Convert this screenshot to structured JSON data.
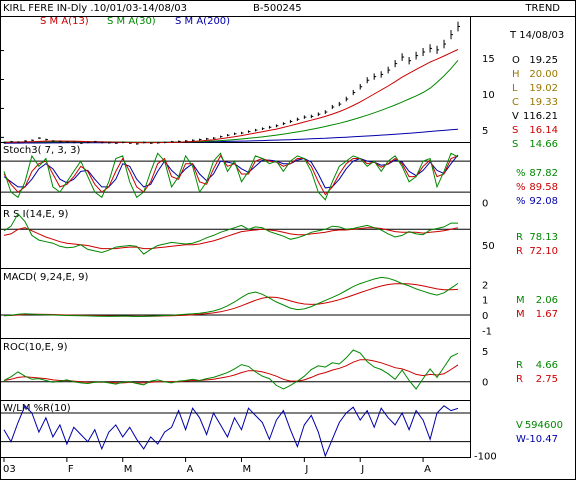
{
  "header": {
    "title": "KIRL FERE IN-Dly .10/01/03-14/08/03",
    "code": "B-500245",
    "trend_label": "TREND",
    "sma_labels": [
      {
        "text": "S M A(13)",
        "color": "#cc0000"
      },
      {
        "text": "S M A(30)",
        "color": "#008800"
      },
      {
        "text": "S M A(200)",
        "color": "#0000aa"
      }
    ]
  },
  "price_info": {
    "date": "T 14/08/03",
    "rows": [
      {
        "k": "O",
        "v": "19.25",
        "color": "#000000"
      },
      {
        "k": "H",
        "v": "20.00",
        "color": "#997700"
      },
      {
        "k": "L",
        "v": "19.02",
        "color": "#997700"
      },
      {
        "k": "C",
        "v": "19.33",
        "color": "#997700"
      },
      {
        "k": "V",
        "v": "116.21",
        "color": "#000000"
      },
      {
        "k": "S",
        "v": "16.14",
        "color": "#cc0000"
      },
      {
        "k": "S",
        "v": "14.66",
        "color": "#008800"
      }
    ]
  },
  "panels": {
    "stoch": {
      "label": "Stoch3( 7, 3, 3)",
      "readouts": [
        {
          "k": "%",
          "v": "87.82",
          "color": "#008800"
        },
        {
          "k": "%",
          "v": "89.58",
          "color": "#cc0000"
        },
        {
          "k": "%",
          "v": "92.08",
          "color": "#0000aa"
        }
      ]
    },
    "rsi": {
      "label": "R S I(14,E, 9)",
      "readouts": [
        {
          "k": "R",
          "v": "78.13",
          "color": "#008800"
        },
        {
          "k": "R",
          "v": "72.10",
          "color": "#cc0000"
        }
      ]
    },
    "macd": {
      "label": "MACD( 9,24,E, 9)",
      "readouts": [
        {
          "k": "M",
          "v": "2.06",
          "color": "#008800"
        },
        {
          "k": "M",
          "v": "1.67",
          "color": "#cc0000"
        }
      ]
    },
    "roc": {
      "label": "ROC(10,E, 9)",
      "readouts": [
        {
          "k": "R",
          "v": "4.66",
          "color": "#008800"
        },
        {
          "k": "R",
          "v": "2.75",
          "color": "#cc0000"
        }
      ]
    },
    "wlm": {
      "label": "W/LM %R(10)",
      "readouts": [
        {
          "k": "V",
          "v": "594600",
          "color": "#008800"
        },
        {
          "k": "W",
          "v": "-10.47",
          "color": "#0000aa"
        }
      ]
    }
  },
  "chart_data": {
    "type": "line",
    "x_month_labels": [
      "03",
      "F",
      "M",
      "A",
      "M",
      "J",
      "J",
      "A"
    ],
    "price_axis_ticks": [
      15,
      10,
      5
    ],
    "stoch_axis_ticks": [
      0
    ],
    "rsi_axis_ticks": [
      50
    ],
    "macd_axis_ticks": [
      2,
      1,
      0,
      -1
    ],
    "roc_axis_ticks": [
      5,
      0
    ],
    "wlm_axis_ticks": [
      -100
    ],
    "price": {
      "ylim": [
        3.5,
        20.5
      ],
      "close": [
        3.3,
        3.4,
        3.35,
        3.5,
        3.6,
        3.9,
        3.7,
        3.5,
        3.4,
        3.35,
        3.3,
        3.2,
        3.3,
        3.4,
        3.3,
        3.25,
        3.2,
        3.3,
        3.2,
        3.1,
        3.3,
        3.2,
        3.25,
        3.3,
        3.4,
        3.45,
        3.5,
        3.6,
        3.7,
        3.8,
        3.9,
        4.1,
        4.3,
        4.5,
        4.6,
        4.8,
        5.0,
        5.2,
        5.4,
        5.6,
        5.9,
        6.2,
        6.5,
        6.8,
        6.9,
        7.2,
        7.5,
        8.2,
        8.6,
        9.3,
        10.2,
        11.0,
        11.9,
        12.4,
        12.7,
        13.3,
        14.2,
        15.1,
        14.6,
        15.3,
        15.8,
        16.3,
        16.1,
        16.9,
        18.2,
        19.33
      ],
      "sma13": [
        3.3,
        3.33,
        3.35,
        3.38,
        3.4,
        3.45,
        3.48,
        3.5,
        3.5,
        3.49,
        3.48,
        3.45,
        3.42,
        3.4,
        3.37,
        3.35,
        3.32,
        3.3,
        3.29,
        3.28,
        3.27,
        3.28,
        3.28,
        3.29,
        3.31,
        3.34,
        3.38,
        3.43,
        3.5,
        3.58,
        3.67,
        3.8,
        3.95,
        4.1,
        4.25,
        4.42,
        4.6,
        4.78,
        4.96,
        5.15,
        5.38,
        5.62,
        5.87,
        6.12,
        6.37,
        6.62,
        6.9,
        7.22,
        7.56,
        7.95,
        8.4,
        8.9,
        9.45,
        10.0,
        10.55,
        11.1,
        11.7,
        12.32,
        12.86,
        13.4,
        13.9,
        14.4,
        14.8,
        15.25,
        15.7,
        16.14
      ],
      "sma30": [
        3.35,
        3.36,
        3.36,
        3.37,
        3.37,
        3.38,
        3.38,
        3.39,
        3.39,
        3.39,
        3.39,
        3.39,
        3.38,
        3.38,
        3.38,
        3.37,
        3.36,
        3.36,
        3.35,
        3.34,
        3.34,
        3.33,
        3.33,
        3.33,
        3.34,
        3.35,
        3.37,
        3.39,
        3.42,
        3.46,
        3.5,
        3.56,
        3.62,
        3.7,
        3.78,
        3.87,
        3.97,
        4.07,
        4.19,
        4.31,
        4.45,
        4.6,
        4.76,
        4.93,
        5.11,
        5.3,
        5.5,
        5.72,
        5.95,
        6.2,
        6.47,
        6.76,
        7.07,
        7.4,
        7.74,
        8.1,
        8.48,
        8.88,
        9.3,
        9.74,
        10.2,
        10.8,
        11.6,
        12.5,
        13.5,
        14.66
      ],
      "sma200": [
        3.2,
        3.21,
        3.21,
        3.22,
        3.22,
        3.23,
        3.23,
        3.24,
        3.24,
        3.25,
        3.25,
        3.26,
        3.26,
        3.27,
        3.27,
        3.28,
        3.28,
        3.29,
        3.29,
        3.3,
        3.3,
        3.31,
        3.31,
        3.32,
        3.33,
        3.34,
        3.35,
        3.36,
        3.37,
        3.38,
        3.4,
        3.42,
        3.44,
        3.46,
        3.48,
        3.5,
        3.53,
        3.56,
        3.59,
        3.62,
        3.65,
        3.68,
        3.72,
        3.76,
        3.8,
        3.84,
        3.88,
        3.93,
        3.98,
        4.03,
        4.08,
        4.13,
        4.19,
        4.25,
        4.31,
        4.37,
        4.44,
        4.51,
        4.58,
        4.65,
        4.73,
        4.81,
        4.89,
        4.97,
        5.05,
        5.13
      ]
    },
    "stoch": {
      "ylim": [
        -5,
        115
      ],
      "guides": [
        20,
        80
      ],
      "k": [
        60,
        20,
        10,
        40,
        90,
        70,
        85,
        30,
        20,
        40,
        60,
        80,
        50,
        20,
        10,
        40,
        85,
        90,
        40,
        10,
        20,
        60,
        95,
        80,
        30,
        50,
        90,
        70,
        20,
        40,
        80,
        95,
        60,
        80,
        40,
        60,
        90,
        85,
        75,
        80,
        60,
        80,
        90,
        85,
        60,
        20,
        5,
        40,
        70,
        80,
        90,
        85,
        70,
        80,
        60,
        80,
        90,
        70,
        40,
        50,
        80,
        85,
        30,
        60,
        95,
        88
      ],
      "d": [
        55,
        35,
        20,
        30,
        60,
        75,
        80,
        55,
        30,
        35,
        50,
        70,
        60,
        35,
        20,
        30,
        60,
        85,
        60,
        30,
        20,
        40,
        75,
        85,
        50,
        45,
        75,
        75,
        40,
        35,
        65,
        90,
        70,
        75,
        55,
        55,
        80,
        85,
        80,
        78,
        70,
        75,
        85,
        85,
        70,
        40,
        15,
        30,
        55,
        75,
        85,
        85,
        75,
        78,
        68,
        75,
        85,
        75,
        50,
        50,
        70,
        82,
        50,
        55,
        85,
        90
      ],
      "sd": [
        50,
        40,
        30,
        30,
        45,
        65,
        75,
        65,
        45,
        38,
        45,
        60,
        62,
        45,
        30,
        30,
        45,
        75,
        70,
        45,
        30,
        35,
        60,
        80,
        62,
        50,
        65,
        75,
        55,
        42,
        55,
        80,
        78,
        75,
        65,
        58,
        70,
        82,
        82,
        80,
        75,
        75,
        82,
        85,
        78,
        55,
        28,
        30,
        45,
        65,
        80,
        85,
        80,
        78,
        72,
        74,
        82,
        78,
        60,
        52,
        62,
        78,
        62,
        56,
        75,
        92
      ]
    },
    "rsi": {
      "ylim": [
        20,
        100
      ],
      "guide": 70,
      "rsi": [
        68,
        74,
        90,
        80,
        62,
        56,
        54,
        52,
        48,
        46,
        47,
        50,
        44,
        42,
        40,
        43,
        47,
        48,
        49,
        48,
        38,
        44,
        49,
        51,
        53,
        52,
        51,
        52,
        55,
        59,
        62,
        66,
        69,
        72,
        75,
        70,
        73,
        72,
        67,
        64,
        61,
        57,
        59,
        62,
        66,
        68,
        70,
        74,
        73,
        70,
        71,
        73,
        75,
        72,
        69,
        64,
        60,
        62,
        67,
        64,
        63,
        69,
        71,
        73,
        78,
        78
      ],
      "signal": [
        62,
        64,
        70,
        72,
        68,
        64,
        60,
        57,
        54,
        52,
        51,
        50,
        49,
        47,
        45,
        45,
        45,
        46,
        47,
        47,
        45,
        45,
        46,
        47,
        48,
        49,
        50,
        50,
        51,
        53,
        55,
        58,
        61,
        64,
        67,
        68,
        69,
        70,
        69,
        68,
        66,
        64,
        63,
        63,
        64,
        65,
        66,
        68,
        69,
        69,
        70,
        71,
        72,
        72,
        71,
        69,
        67,
        66,
        66,
        66,
        65,
        66,
        67,
        68,
        70,
        72
      ]
    },
    "macd": {
      "ylim": [
        -1.5,
        3.0
      ],
      "guide": 0,
      "macd": [
        -0.05,
        -0.02,
        0.05,
        0.08,
        0.06,
        0.03,
        0.02,
        0.0,
        -0.02,
        -0.03,
        -0.04,
        -0.05,
        -0.06,
        -0.07,
        -0.08,
        -0.09,
        -0.08,
        -0.07,
        -0.08,
        -0.1,
        -0.09,
        -0.07,
        -0.05,
        -0.03,
        -0.01,
        0.02,
        0.05,
        0.08,
        0.12,
        0.18,
        0.26,
        0.4,
        0.6,
        0.85,
        1.15,
        1.4,
        1.5,
        1.35,
        1.1,
        0.85,
        0.65,
        0.45,
        0.35,
        0.4,
        0.55,
        0.75,
        0.95,
        1.15,
        1.35,
        1.6,
        1.85,
        2.05,
        2.2,
        2.35,
        2.45,
        2.4,
        2.25,
        2.05,
        1.9,
        1.7,
        1.55,
        1.4,
        1.3,
        1.45,
        1.75,
        2.06
      ],
      "signal": [
        -0.04,
        -0.03,
        0.0,
        0.03,
        0.05,
        0.05,
        0.04,
        0.03,
        0.02,
        0.0,
        -0.01,
        -0.02,
        -0.03,
        -0.04,
        -0.05,
        -0.06,
        -0.07,
        -0.07,
        -0.07,
        -0.08,
        -0.08,
        -0.08,
        -0.07,
        -0.06,
        -0.05,
        -0.03,
        -0.01,
        0.02,
        0.05,
        0.09,
        0.14,
        0.21,
        0.31,
        0.44,
        0.6,
        0.78,
        0.96,
        1.1,
        1.17,
        1.15,
        1.05,
        0.92,
        0.8,
        0.72,
        0.69,
        0.71,
        0.78,
        0.88,
        1.0,
        1.14,
        1.3,
        1.46,
        1.61,
        1.76,
        1.89,
        1.99,
        2.04,
        2.05,
        2.03,
        1.98,
        1.9,
        1.8,
        1.7,
        1.65,
        1.65,
        1.67
      ]
    },
    "roc": {
      "ylim": [
        -3,
        7
      ],
      "guide": 0,
      "roc": [
        0.2,
        0.8,
        1.6,
        0.9,
        0.4,
        0.5,
        0.2,
        -0.1,
        0.1,
        0.3,
        0.0,
        -0.2,
        -0.3,
        -0.1,
        0.0,
        -0.2,
        -0.4,
        -0.1,
        0.0,
        -0.3,
        -0.5,
        0.1,
        0.3,
        0.0,
        -0.2,
        0.1,
        0.2,
        0.4,
        0.2,
        0.5,
        0.7,
        1.1,
        1.5,
        2.1,
        2.8,
        2.5,
        1.6,
        0.9,
        0.5,
        -0.6,
        -1.2,
        -0.6,
        0.1,
        0.9,
        2.0,
        2.6,
        2.4,
        3.1,
        2.9,
        3.9,
        5.2,
        4.7,
        3.3,
        2.4,
        2.0,
        1.3,
        0.4,
        1.9,
        0.2,
        -1.2,
        0.5,
        2.1,
        0.7,
        2.4,
        4.1,
        4.66
      ],
      "signal": [
        0.2,
        0.4,
        0.7,
        0.8,
        0.7,
        0.6,
        0.5,
        0.3,
        0.2,
        0.2,
        0.1,
        0.0,
        -0.1,
        -0.1,
        -0.1,
        -0.1,
        -0.2,
        -0.2,
        -0.1,
        -0.2,
        -0.2,
        -0.1,
        0.0,
        0.0,
        0.0,
        0.0,
        0.1,
        0.2,
        0.2,
        0.3,
        0.4,
        0.6,
        0.8,
        1.1,
        1.5,
        1.8,
        1.8,
        1.6,
        1.3,
        0.9,
        0.4,
        0.1,
        0.1,
        0.3,
        0.7,
        1.2,
        1.5,
        1.9,
        2.2,
        2.6,
        3.2,
        3.6,
        3.6,
        3.4,
        3.1,
        2.7,
        2.3,
        2.1,
        1.7,
        1.2,
        1.0,
        1.2,
        1.1,
        1.3,
        2.0,
        2.75
      ]
    },
    "wlm": {
      "ylim": [
        -112,
        5
      ],
      "guides": [
        -20,
        -80
      ],
      "w": [
        -55,
        -80,
        -40,
        -5,
        -20,
        -60,
        -30,
        -70,
        -45,
        -85,
        -50,
        -65,
        -80,
        -55,
        -95,
        -60,
        -45,
        -70,
        -50,
        -75,
        -95,
        -70,
        -85,
        -60,
        -50,
        -15,
        -55,
        -10,
        -30,
        -65,
        -20,
        -45,
        -70,
        -30,
        -55,
        -10,
        -25,
        -40,
        -75,
        -35,
        -15,
        -55,
        -90,
        -45,
        -25,
        -60,
        -110,
        -75,
        -40,
        -20,
        -8,
        -35,
        -15,
        -50,
        -10,
        -30,
        -45,
        -20,
        -55,
        -15,
        -35,
        -75,
        -20,
        -5,
        -15,
        -10.47
      ]
    }
  }
}
